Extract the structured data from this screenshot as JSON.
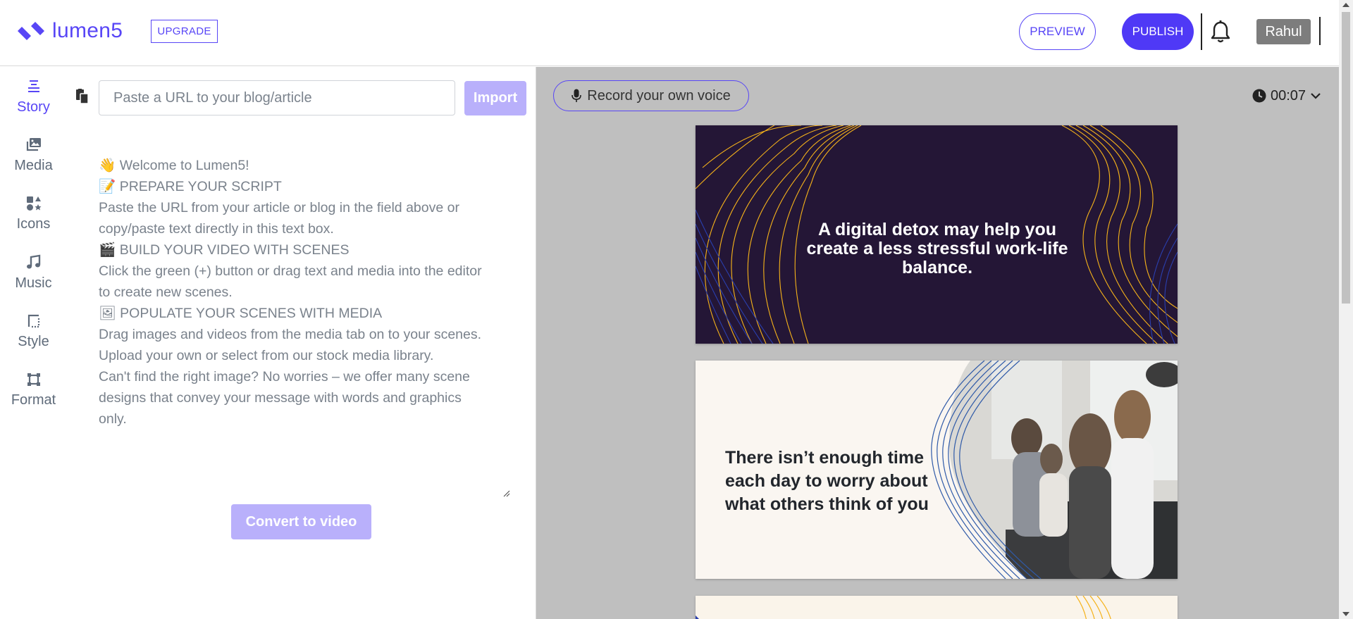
{
  "app": {
    "brand": "lumen5",
    "accent": "#5846f6"
  },
  "header": {
    "upgrade_label": "UPGRADE",
    "preview_label": "PREVIEW",
    "publish_label": "PUBLISH",
    "user_name": "Rahul",
    "icons": {
      "notifications": "bell-icon",
      "logo": "lumen5-logo"
    }
  },
  "sidebar": {
    "items": [
      {
        "label": "Story",
        "icon": "story-icon",
        "active": true
      },
      {
        "label": "Media",
        "icon": "media-icon"
      },
      {
        "label": "Icons",
        "icon": "icons-icon"
      },
      {
        "label": "Music",
        "icon": "music-icon"
      },
      {
        "label": "Style",
        "icon": "style-icon"
      },
      {
        "label": "Format",
        "icon": "format-icon"
      }
    ]
  },
  "story": {
    "url_placeholder": "Paste a URL to your blog/article",
    "import_label": "Import",
    "script_lines": [
      "👋 Welcome to Lumen5!",
      " 📝 PREPARE YOUR SCRIPT",
      "Paste the URL from your article or blog in the field above or",
      "copy/paste text directly in this text box.",
      " 🎬 BUILD YOUR VIDEO WITH SCENES",
      "Click the green (+) button or drag text and media into the editor",
      "to create new scenes.",
      " 🖼 POPULATE YOUR SCENES WITH MEDIA",
      "Drag images and videos from the media tab on to your scenes.",
      "Upload your own or select from our stock media library.",
      " Can't find the right image? No worries – we offer many scene",
      "designs that convey your message with words and graphics",
      "only."
    ],
    "convert_label": "Convert to video"
  },
  "preview": {
    "record_voice_label": "Record your own voice",
    "duration": "00:07",
    "scenes": [
      {
        "caption": "A digital detox may help you create a less stressful work-life balance."
      },
      {
        "caption": "There isn’t enough time each day to worry about what others think of you"
      }
    ]
  }
}
